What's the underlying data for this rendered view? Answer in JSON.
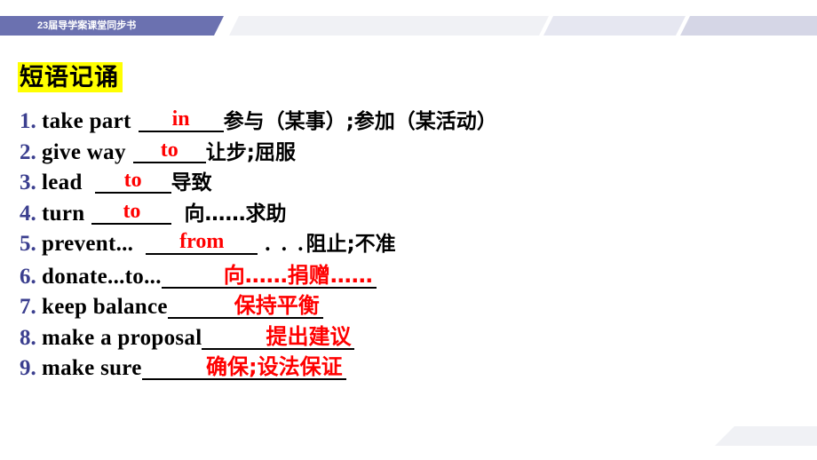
{
  "header": {
    "banner_label": "23届导学案课堂同步书",
    "purple_color": "#6b71b0",
    "band_colors": [
      "#f0f1f5",
      "#e6e7f1",
      "#d5d6e6"
    ]
  },
  "section": {
    "title": "短语记诵",
    "highlight_color": "#ffff00",
    "title_color": "#000000"
  },
  "colors": {
    "number": "#3b3f8f",
    "answer_red": "#ff0000",
    "english": "#000000",
    "chinese": "#000000"
  },
  "phrases": [
    {
      "num": "1.",
      "english": "take  part",
      "answer": "in",
      "answer_color": "#ff0000",
      "chinese": "参与（某事）;参加（某活动）",
      "chinese_color": "#000000",
      "trailing_dots": ""
    },
    {
      "num": "2.",
      "english": "give  way",
      "answer": "to",
      "answer_color": "#ff0000",
      "chinese": "让步;屈服",
      "chinese_color": "#000000",
      "trailing_dots": ""
    },
    {
      "num": "3.",
      "english": "lead",
      "answer": "to",
      "answer_color": "#ff0000",
      "chinese": "导致",
      "chinese_color": "#000000",
      "trailing_dots": ""
    },
    {
      "num": "4.",
      "english": "turn",
      "answer": "to",
      "answer_color": "#ff0000",
      "chinese": "向……求助",
      "chinese_color": "#000000",
      "trailing_dots": ""
    },
    {
      "num": "5.",
      "english": "prevent...",
      "answer": "from",
      "answer_color": "#ff0000",
      "chinese": "阻止;不准",
      "chinese_color": "#000000",
      "trailing_dots": ". . ."
    },
    {
      "num": "6.",
      "english": "donate...to...",
      "answer": "向……捐赠……",
      "answer_color": "#ff0000",
      "chinese": "",
      "chinese_color": "#ff0000",
      "trailing_dots": ""
    },
    {
      "num": "7.",
      "english": "keep  balance",
      "answer": "保持平衡",
      "answer_color": "#ff0000",
      "chinese": "",
      "chinese_color": "#ff0000",
      "trailing_dots": ""
    },
    {
      "num": "8.",
      "english": "make  a  proposal",
      "answer": "提出建议",
      "answer_color": "#ff0000",
      "chinese": "",
      "chinese_color": "#ff0000",
      "trailing_dots": ""
    },
    {
      "num": "9.",
      "english": "make  sure",
      "answer": "确保;设法保证",
      "answer_color": "#ff0000",
      "chinese": "",
      "chinese_color": "#ff0000",
      "trailing_dots": ""
    }
  ]
}
